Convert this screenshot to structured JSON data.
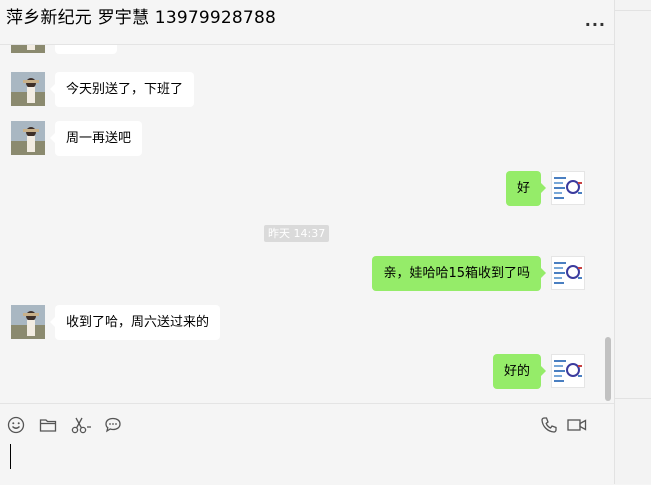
{
  "header": {
    "title": "萍乡新纪元 罗宇慧 13979928788",
    "more_label": "..."
  },
  "timestamp": "昨天 14:37",
  "messages": [
    {
      "side": "left",
      "text": "",
      "partial": true
    },
    {
      "side": "left",
      "text": "今天别送了，下班了"
    },
    {
      "side": "left",
      "text": "周一再送吧"
    },
    {
      "side": "right",
      "text": "好"
    },
    {
      "side": "right",
      "text": "亲，娃哈哈15箱收到了吗"
    },
    {
      "side": "left",
      "text": "收到了哈，周六送过来的"
    },
    {
      "side": "right",
      "text": "好的"
    }
  ],
  "toolbar": {
    "left_icons": [
      "emoji-icon",
      "folder-icon",
      "scissors-icon",
      "chat-bubble-icon"
    ],
    "right_icons": [
      "phone-icon",
      "video-icon"
    ]
  },
  "colors": {
    "background": "#f5f5f5",
    "bubble_sent": "#95ec69",
    "bubble_received": "#ffffff",
    "timestamp_bg": "#dadada"
  }
}
